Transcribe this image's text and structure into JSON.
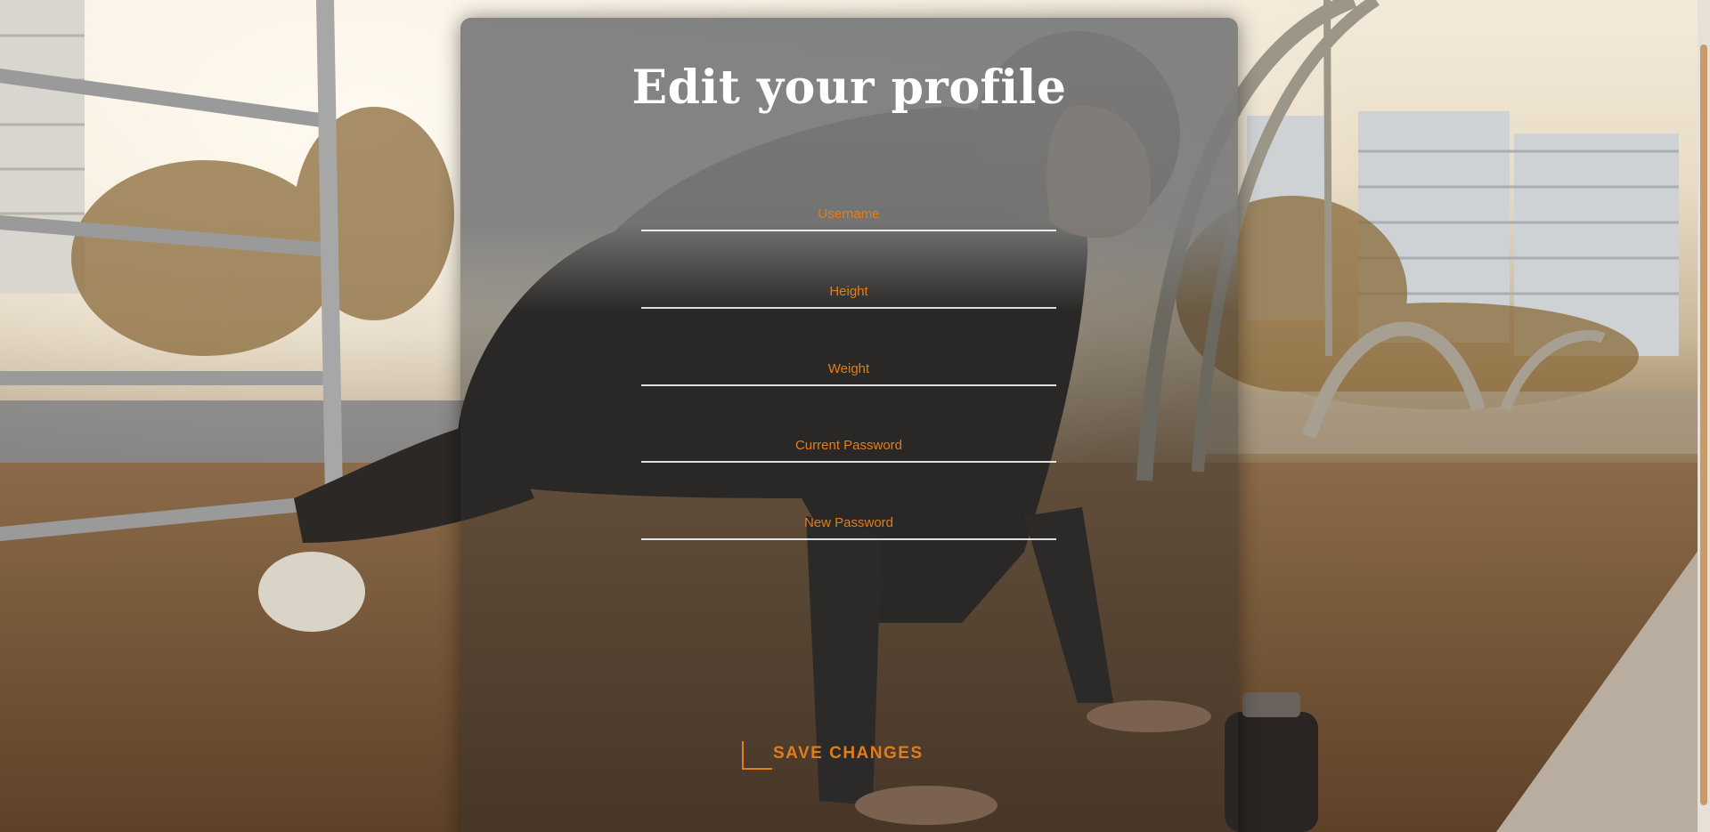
{
  "background": {
    "image_subject": "man doing a push-up in an outdoor gym"
  },
  "profile_form": {
    "title": "Edit your profile",
    "fields": [
      {
        "key": "username",
        "placeholder": "Username",
        "value": ""
      },
      {
        "key": "height",
        "placeholder": "Height",
        "value": ""
      },
      {
        "key": "weight",
        "placeholder": "Weight",
        "value": ""
      },
      {
        "key": "current_password",
        "placeholder": "Current Password",
        "value": ""
      },
      {
        "key": "new_password",
        "placeholder": "New Password",
        "value": ""
      }
    ],
    "save_label": "SAVE CHANGES"
  },
  "colors": {
    "accent": "#e27d1a",
    "title": "#ffffff",
    "field_underline": "#ffffff"
  }
}
